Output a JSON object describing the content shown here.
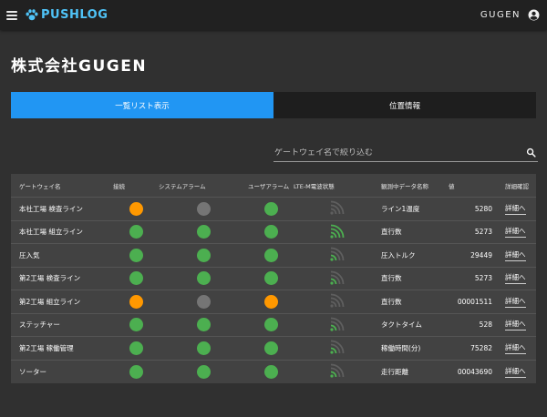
{
  "app": {
    "logo_text": "PUSHLOG",
    "user_name": "GUGEN",
    "icons": {
      "menu": "hamburger-menu-icon",
      "logo": "paw-icon",
      "account": "account-circle-icon",
      "search": "search-icon"
    }
  },
  "company_name": "株式会社GUGEN",
  "tabs": [
    {
      "label": "一覧リスト表示",
      "active": true
    },
    {
      "label": "位置情報",
      "active": false
    }
  ],
  "search": {
    "placeholder": "ゲートウェイ名で絞り込む",
    "value": ""
  },
  "colors": {
    "ok": "#4caf50",
    "warning": "#ff9800",
    "inactive": "#757575",
    "signal_on": "#4caf50",
    "signal_off": "#5f5f5f",
    "accent": "#2196f3",
    "logo": "#4fc3f7"
  },
  "table": {
    "headers": [
      "ゲートウェイ名",
      "接続",
      "システムアラーム",
      "ユーザアラーム",
      "LTE-M電波状態",
      "観測中データ名称",
      "値",
      "詳細確認"
    ],
    "rows": [
      {
        "name": "本社工場 検査ライン",
        "connection": "warning",
        "system_alarm": "inactive",
        "user_alarm": "ok",
        "signal_bars": 0,
        "data_name": "ライン1温度",
        "value": "5280",
        "detail": "詳細へ"
      },
      {
        "name": "本社工場 組立ライン",
        "connection": "ok",
        "system_alarm": "ok",
        "user_alarm": "ok",
        "signal_bars": 3,
        "data_name": "直行数",
        "value": "5273",
        "detail": "詳細へ"
      },
      {
        "name": "圧入気",
        "connection": "ok",
        "system_alarm": "ok",
        "user_alarm": "ok",
        "signal_bars": 1,
        "data_name": "圧入トルク",
        "value": "29449",
        "detail": "詳細へ"
      },
      {
        "name": "第2工場 検査ライン",
        "connection": "ok",
        "system_alarm": "ok",
        "user_alarm": "ok",
        "signal_bars": 1,
        "data_name": "直行数",
        "value": "5273",
        "detail": "詳細へ"
      },
      {
        "name": "第2工場 組立ライン",
        "connection": "warning",
        "system_alarm": "inactive",
        "user_alarm": "warning",
        "signal_bars": 0,
        "data_name": "直行数",
        "value": "00001511",
        "detail": "詳細へ"
      },
      {
        "name": "ステッチャー",
        "connection": "ok",
        "system_alarm": "ok",
        "user_alarm": "ok",
        "signal_bars": 1,
        "data_name": "タクトタイム",
        "value": "528",
        "detail": "詳細へ"
      },
      {
        "name": "第2工場 稼働管理",
        "connection": "ok",
        "system_alarm": "ok",
        "user_alarm": "ok",
        "signal_bars": 1,
        "data_name": "稼働時間(分)",
        "value": "75282",
        "detail": "詳細へ"
      },
      {
        "name": "ソーター",
        "connection": "ok",
        "system_alarm": "ok",
        "user_alarm": "ok",
        "signal_bars": 1,
        "data_name": "走行距離",
        "value": "00043690",
        "detail": "詳細へ"
      }
    ]
  }
}
